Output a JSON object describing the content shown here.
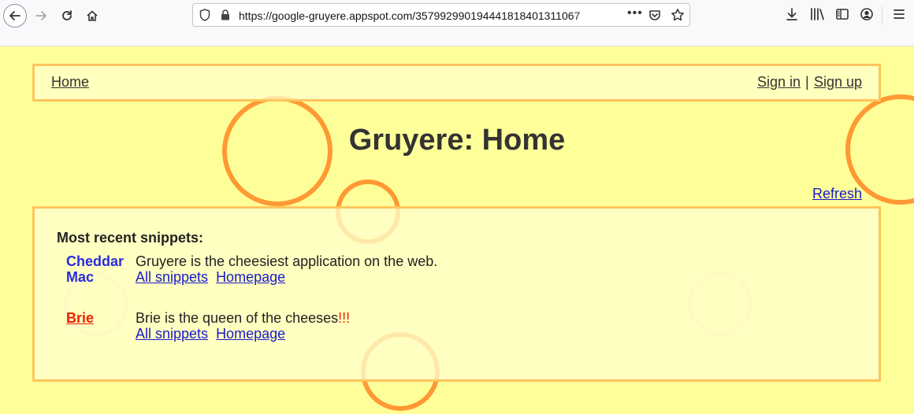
{
  "browser": {
    "url": "https://google-gruyere.appspot.com/357992990194441818401311067",
    "url_more": "•••",
    "icons": [
      "back-icon",
      "forward-icon",
      "reload-icon",
      "home-icon",
      "shield-icon",
      "lock-icon",
      "pocket-icon",
      "star-icon",
      "download-icon",
      "library-icon",
      "sidebar-icon",
      "account-icon",
      "menu-icon"
    ]
  },
  "menubar": {
    "home": "Home",
    "sign_in": "Sign in",
    "separator": "|",
    "sign_up": "Sign up"
  },
  "page": {
    "title": "Gruyere: Home",
    "refresh": "Refresh"
  },
  "snippets": {
    "heading": "Most recent snippets:",
    "items": [
      {
        "author_line1": "Cheddar",
        "author_line2": "Mac",
        "text": "Gruyere is the cheesiest application on the web.",
        "emphasis": "",
        "all_snippets": "All snippets",
        "homepage": "Homepage"
      },
      {
        "author_line1": "Brie",
        "text": "Brie is the queen of the cheeses",
        "emphasis": "!!!",
        "all_snippets": "All snippets",
        "homepage": "Homepage"
      }
    ]
  },
  "colors": {
    "page_bg": "#ffff99",
    "panel_border": "#ffc45c",
    "circle_orange": "#ff9933",
    "circle_pale": "#ffe6a8",
    "link": "#1a1acc",
    "author_blue": "#2a2ae0",
    "author_red": "#ee2200"
  }
}
